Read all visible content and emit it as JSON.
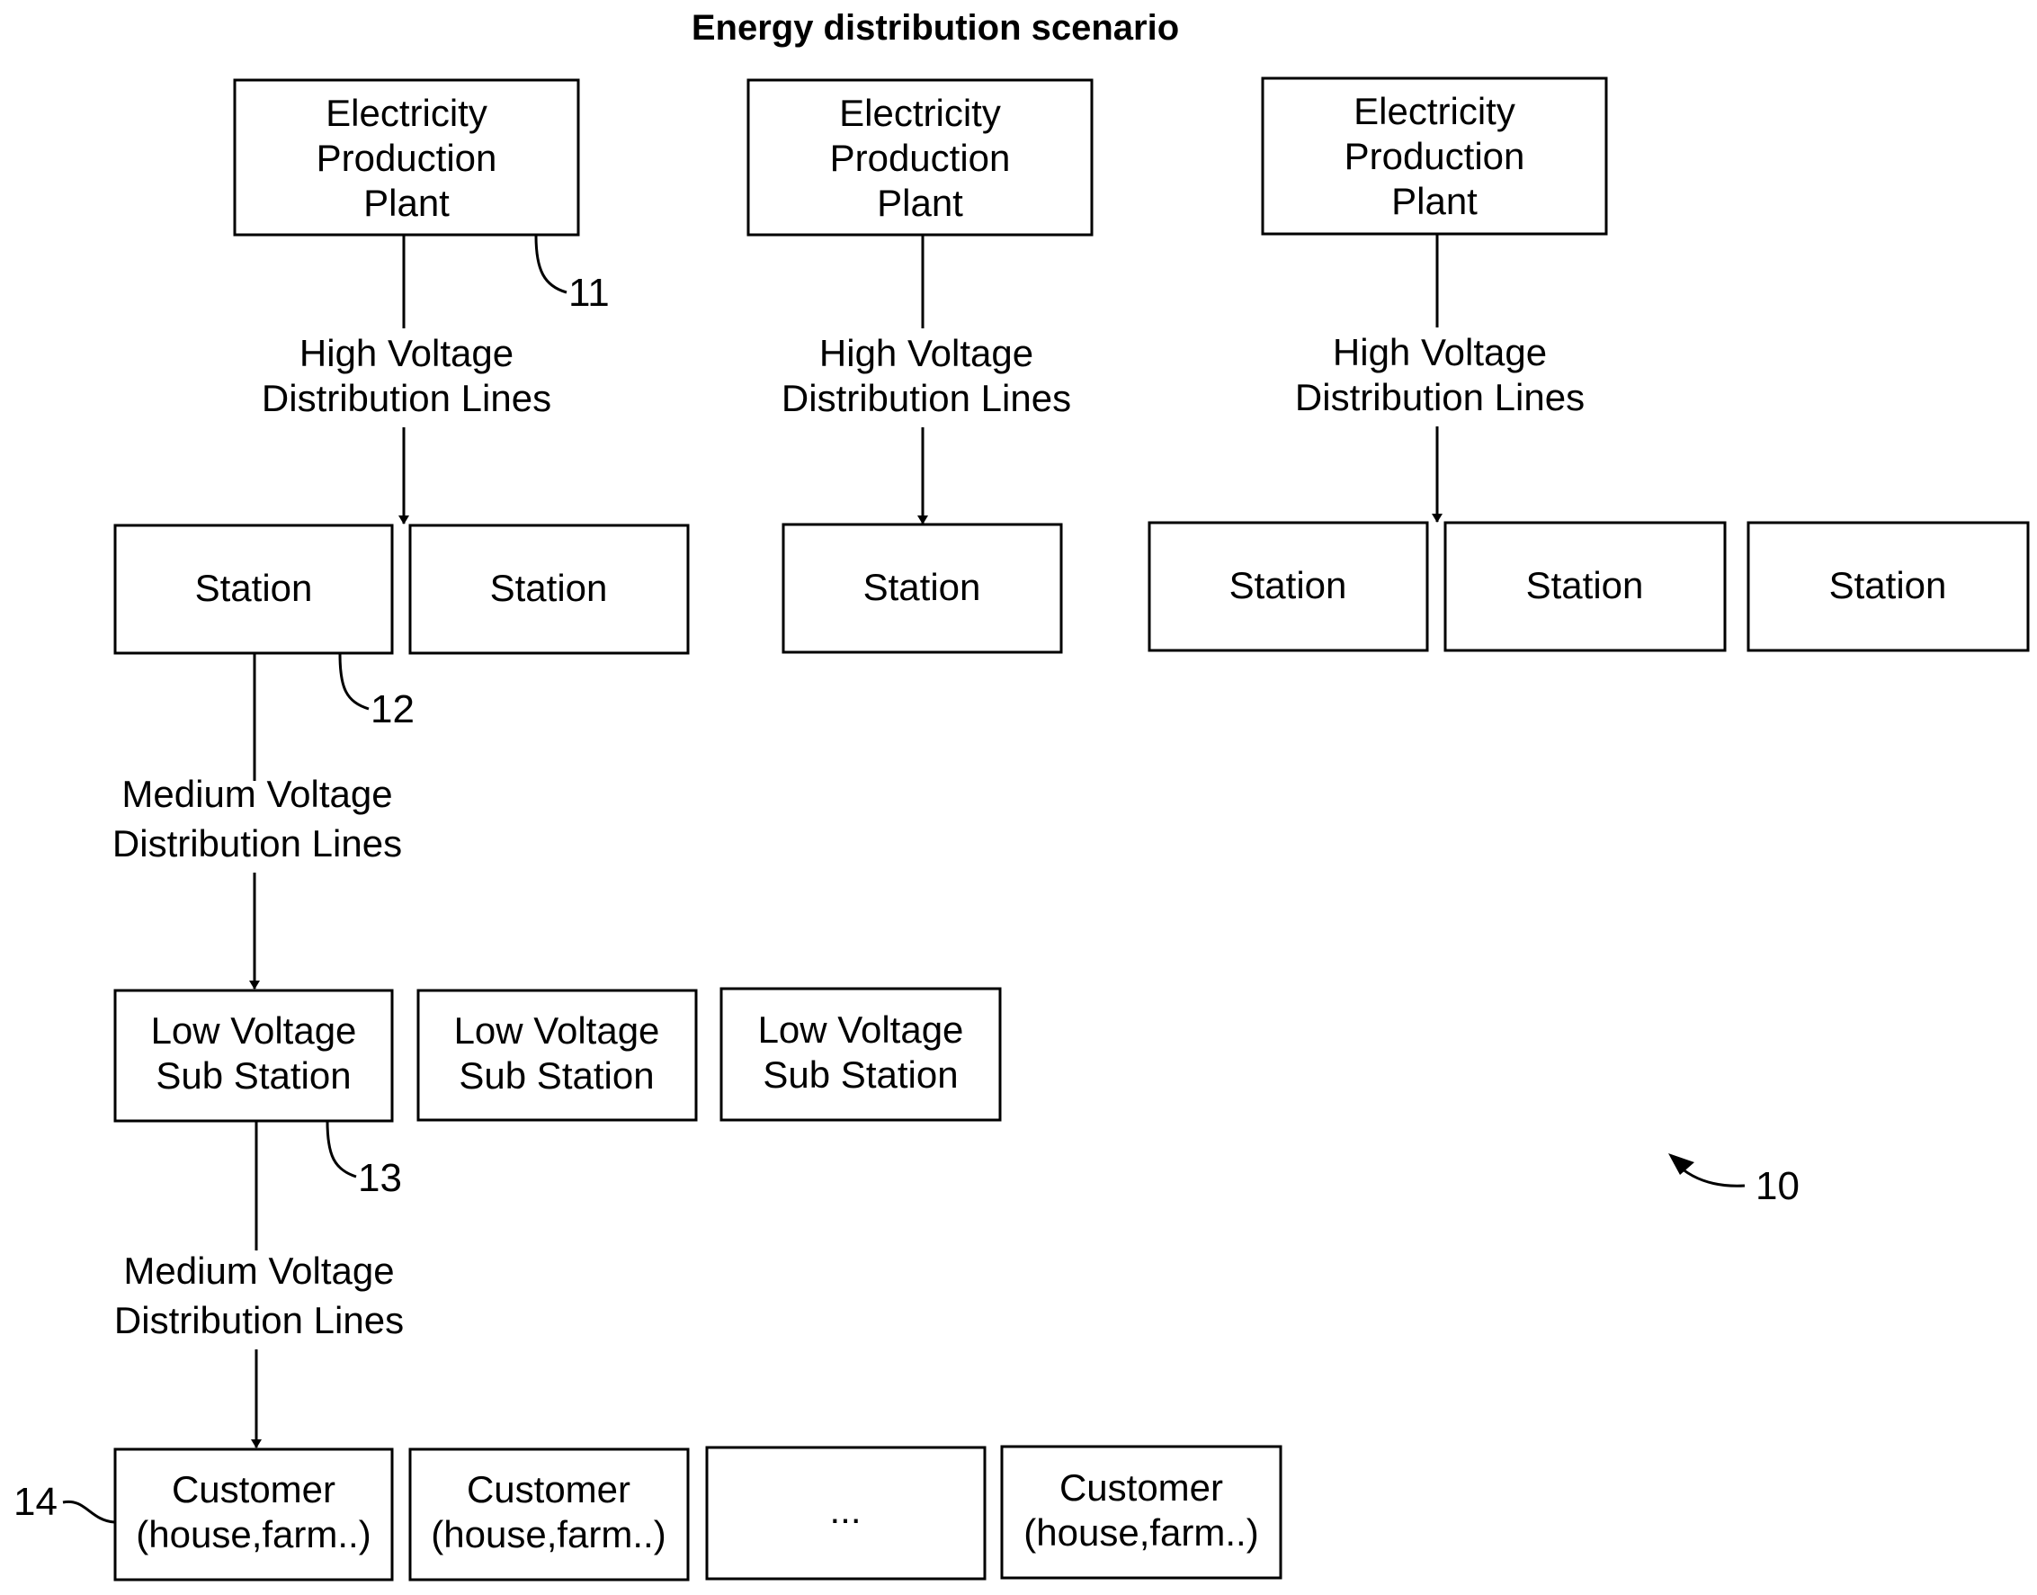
{
  "title": "Energy distribution scenario",
  "plants": [
    {
      "lines": [
        "Electricity",
        "Production",
        "Plant"
      ]
    },
    {
      "lines": [
        "Electricity",
        "Production",
        "Plant"
      ]
    },
    {
      "lines": [
        "Electricity",
        "Production",
        "Plant"
      ]
    }
  ],
  "high_voltage_labels": [
    {
      "lines": [
        "High Voltage",
        "Distribution Lines"
      ]
    },
    {
      "lines": [
        "High Voltage",
        "Distribution Lines"
      ]
    },
    {
      "lines": [
        "High Voltage",
        "Distribution Lines"
      ]
    }
  ],
  "stations": [
    {
      "label": "Station"
    },
    {
      "label": "Station"
    },
    {
      "label": "Station"
    },
    {
      "label": "Station"
    },
    {
      "label": "Station"
    },
    {
      "label": "Station"
    }
  ],
  "medium_voltage_labels": [
    {
      "lines": [
        "Medium Voltage",
        "Distribution Lines"
      ]
    },
    {
      "lines": [
        "Medium Voltage",
        "Distribution Lines"
      ]
    }
  ],
  "substations": [
    {
      "lines": [
        "Low Voltage",
        "Sub Station"
      ]
    },
    {
      "lines": [
        "Low Voltage",
        "Sub Station"
      ]
    },
    {
      "lines": [
        "Low Voltage",
        "Sub Station"
      ]
    }
  ],
  "customers": [
    {
      "lines": [
        "Customer",
        "(house,farm..)"
      ]
    },
    {
      "lines": [
        "Customer",
        "(house,farm..)"
      ]
    },
    {
      "lines": [
        "..."
      ]
    },
    {
      "lines": [
        "Customer",
        "(house,farm..)"
      ]
    }
  ],
  "reference_numerals": {
    "system": "10",
    "plant": "11",
    "station": "12",
    "substation": "13",
    "customer": "14"
  }
}
